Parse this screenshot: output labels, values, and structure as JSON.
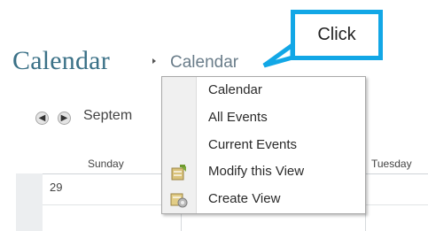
{
  "header": {
    "title": "Calendar",
    "breadcrumb_view": "Calendar"
  },
  "callout": {
    "label": "Click",
    "color": "#12a7e6"
  },
  "navigation": {
    "prev_icon": "arrow-left-icon",
    "next_icon": "arrow-right-icon",
    "month_label": "Septem"
  },
  "calendar_grid": {
    "day_headers": [
      "Sunday",
      "Tuesday"
    ],
    "first_date": "29"
  },
  "view_menu": {
    "items": [
      {
        "label": "Calendar",
        "icon": ""
      },
      {
        "label": "All Events",
        "icon": ""
      },
      {
        "label": "Current Events",
        "icon": ""
      },
      {
        "label": "Modify this View",
        "icon": "modify-view-icon"
      },
      {
        "label": "Create View",
        "icon": "create-view-icon"
      }
    ]
  },
  "colors": {
    "title": "#3b7187",
    "breadcrumb": "#6a7d8a"
  }
}
